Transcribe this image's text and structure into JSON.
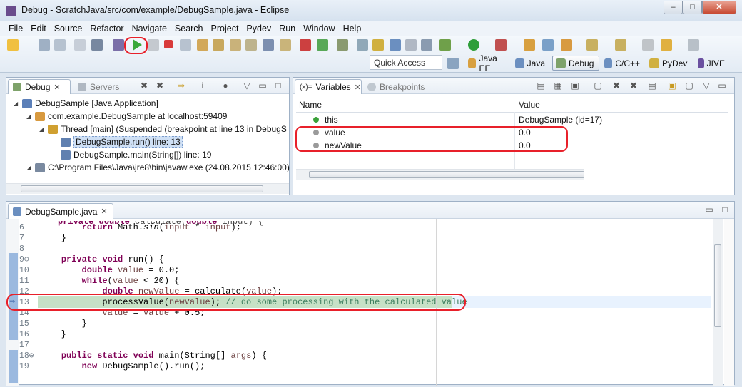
{
  "window": {
    "title": "Debug - ScratchJava/src/com/example/DebugSample.java - Eclipse",
    "minimize_glyph": "–",
    "maximize_glyph": "□",
    "close_glyph": "✕"
  },
  "menu": [
    "File",
    "Edit",
    "Source",
    "Refactor",
    "Navigate",
    "Search",
    "Project",
    "Pydev",
    "Run",
    "Window",
    "Help"
  ],
  "toolbar": {
    "quick_access_placeholder": "Quick Access",
    "perspectives": [
      {
        "label": "Java EE",
        "icon": "java-ee-icon"
      },
      {
        "label": "Java",
        "icon": "java-icon"
      },
      {
        "label": "Debug",
        "icon": "debug-bug-icon",
        "active": true
      },
      {
        "label": "C/C++",
        "icon": "cpp-icon"
      },
      {
        "label": "PyDev",
        "icon": "pydev-icon"
      },
      {
        "label": "JIVE",
        "icon": "jive-icon"
      }
    ]
  },
  "debug_view": {
    "tabs": [
      {
        "label": "Debug",
        "active": true
      },
      {
        "label": "Servers",
        "active": false
      }
    ],
    "tree": [
      {
        "text": "DebugSample [Java Application]",
        "level": 0,
        "icon": "java-app-icon"
      },
      {
        "text": "com.example.DebugSample at localhost:59409",
        "level": 1,
        "icon": "vm-icon"
      },
      {
        "text": "Thread [main] (Suspended (breakpoint at line 13 in DebugS",
        "level": 2,
        "icon": "thread-icon"
      },
      {
        "text": "DebugSample.run() line: 13",
        "level": 3,
        "icon": "stack-frame-icon",
        "selected": true
      },
      {
        "text": "DebugSample.main(String[]) line: 19",
        "level": 3,
        "icon": "stack-frame-icon"
      },
      {
        "text": "C:\\Program Files\\Java\\jre8\\bin\\javaw.exe (24.08.2015 12:46:00)",
        "level": 1,
        "icon": "process-icon"
      }
    ]
  },
  "variables_view": {
    "tabs": [
      {
        "label": "Variables",
        "prefix": "(x)=",
        "active": true
      },
      {
        "label": "Breakpoints",
        "active": false
      }
    ],
    "columns": [
      "Name",
      "Value"
    ],
    "rows": [
      {
        "name": "this",
        "value": "DebugSample  (id=17)",
        "dot": "#3aa13a"
      },
      {
        "name": "value",
        "value": "0.0",
        "dot": "#9a9a9a"
      },
      {
        "name": "newValue",
        "value": "0.0",
        "dot": "#9a9a9a"
      }
    ]
  },
  "editor": {
    "tab_label": "DebugSample.java",
    "lines": [
      {
        "n": "6",
        "html": "        <span class=\"kw\">return</span> Math.<span class=\"it\">sin</span>(<span class=\"vr\">input</span> * <span class=\"vr\">input</span>);"
      },
      {
        "n": "7",
        "html": "    }"
      },
      {
        "n": "8",
        "html": ""
      },
      {
        "n": "9⊖",
        "html": "    <span class=\"kw\">private</span> <span class=\"kw\">void</span> run() {"
      },
      {
        "n": "10",
        "html": "        <span class=\"kw\">double</span> <span class=\"vr\">value</span> = 0.0;"
      },
      {
        "n": "11",
        "html": "        <span class=\"kw\">while</span>(<span class=\"vr\">value</span> &lt; 20) {"
      },
      {
        "n": "12",
        "html": "            <span class=\"kw\">double</span> <span class=\"vr\">newValue</span> = calculate(<span class=\"vr\">value</span>);"
      },
      {
        "n": "13",
        "html": "            processValue(<span class=\"vr\">newValue</span>); <span class=\"cm\">// do some processing with the calculated value</span>",
        "current": true
      },
      {
        "n": "14",
        "html": "            <span class=\"vr\">value</span> = <span class=\"vr\">value</span> + 0.5;"
      },
      {
        "n": "15",
        "html": "        }"
      },
      {
        "n": "16",
        "html": "    }"
      },
      {
        "n": "17",
        "html": ""
      },
      {
        "n": "18⊖",
        "html": "    <span class=\"kw\">public</span> <span class=\"kw\">static</span> <span class=\"kw\">void</span> main(String[] <span class=\"vr\">args</span>) {"
      },
      {
        "n": "19",
        "html": "        <span class=\"kw\">new</span> DebugSample().run();"
      }
    ]
  },
  "colors": {
    "highlight_line": "#c6e1c6",
    "annotation_red": "#e8202a",
    "selection": "#cfe0f5"
  }
}
